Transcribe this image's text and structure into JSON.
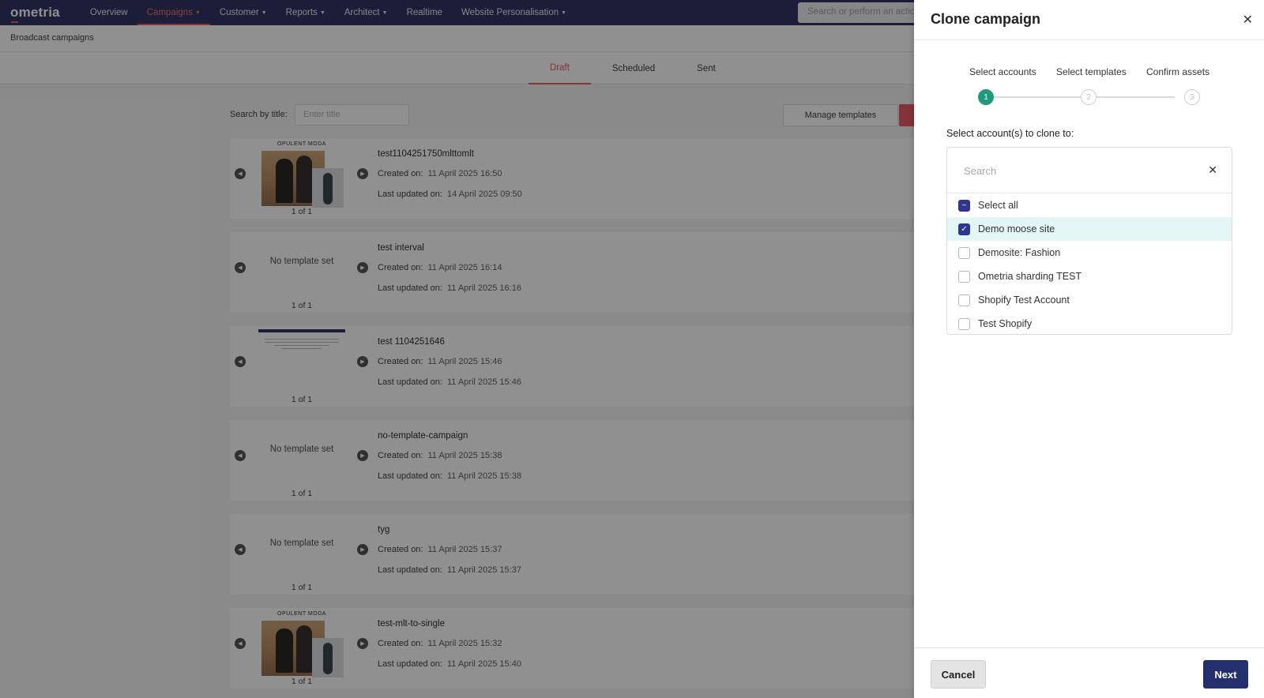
{
  "nav": {
    "logo": "ometria",
    "items": [
      {
        "label": "Overview",
        "dropdown": false,
        "active": false
      },
      {
        "label": "Campaigns",
        "dropdown": true,
        "active": true
      },
      {
        "label": "Customer",
        "dropdown": true,
        "active": false
      },
      {
        "label": "Reports",
        "dropdown": true,
        "active": false
      },
      {
        "label": "Architect",
        "dropdown": true,
        "active": false
      },
      {
        "label": "Realtime",
        "dropdown": false,
        "active": false
      },
      {
        "label": "Website Personalisation",
        "dropdown": true,
        "active": false
      }
    ],
    "search_placeholder": "Search or perform an action"
  },
  "breadcrumb": "Broadcast campaigns",
  "tabs": [
    {
      "label": "Draft",
      "active": true
    },
    {
      "label": "Scheduled",
      "active": false
    },
    {
      "label": "Sent",
      "active": false
    }
  ],
  "list": {
    "search_label": "Search by title:",
    "search_placeholder": "Enter title",
    "manage_templates": "Manage templates",
    "created_label": "Created on:",
    "updated_label": "Last updated on:",
    "no_template": "No template set",
    "brand_text": "OPULENT MODA",
    "campaigns": [
      {
        "title": "test1104251750mlttomlt",
        "created": "11 April 2025 16:50",
        "updated": "14 April 2025 09:50",
        "thumb": "photo",
        "pager": "1 of 1"
      },
      {
        "title": "test interval",
        "created": "11 April 2025 16:14",
        "updated": "11 April 2025 16:16",
        "thumb": "none",
        "pager": "1 of 1"
      },
      {
        "title": "test 1104251646",
        "created": "11 April 2025 15:46",
        "updated": "11 April 2025 15:46",
        "thumb": "email",
        "pager": "1 of 1"
      },
      {
        "title": "no-template-campaign",
        "created": "11 April 2025 15:38",
        "updated": "11 April 2025 15:38",
        "thumb": "none",
        "pager": "1 of 1"
      },
      {
        "title": "tyg",
        "created": "11 April 2025 15:37",
        "updated": "11 April 2025 15:37",
        "thumb": "none",
        "pager": "1 of 1"
      },
      {
        "title": "test-mlt-to-single",
        "created": "11 April 2025 15:32",
        "updated": "11 April 2025 15:40",
        "thumb": "photo",
        "pager": "1 of 1"
      }
    ]
  },
  "drawer": {
    "title": "Clone campaign",
    "steps": [
      {
        "label": "Select accounts",
        "number": "1",
        "active": true
      },
      {
        "label": "Select templates",
        "number": "2",
        "active": false
      },
      {
        "label": "Confirm assets",
        "number": "3",
        "active": false
      }
    ],
    "select_label": "Select account(s) to clone to:",
    "search_placeholder": "Search",
    "accounts": [
      {
        "label": "Select all",
        "state": "partial",
        "selected": false
      },
      {
        "label": "Demo moose site",
        "state": "checked",
        "selected": true
      },
      {
        "label": "Demosite: Fashion",
        "state": "unchecked",
        "selected": false
      },
      {
        "label": "Ometria sharding TEST",
        "state": "unchecked",
        "selected": false
      },
      {
        "label": "Shopify Test Account",
        "state": "unchecked",
        "selected": false
      },
      {
        "label": "Test Shopify",
        "state": "unchecked",
        "selected": false
      }
    ],
    "cancel": "Cancel",
    "next": "Next"
  },
  "colors": {
    "nav_bg": "#24285b",
    "accent_red": "#e8505b",
    "step_active": "#1f9a7d",
    "checkbox": "#2f3592",
    "selected_row": "#e3f5f5",
    "next_button": "#24306e"
  }
}
